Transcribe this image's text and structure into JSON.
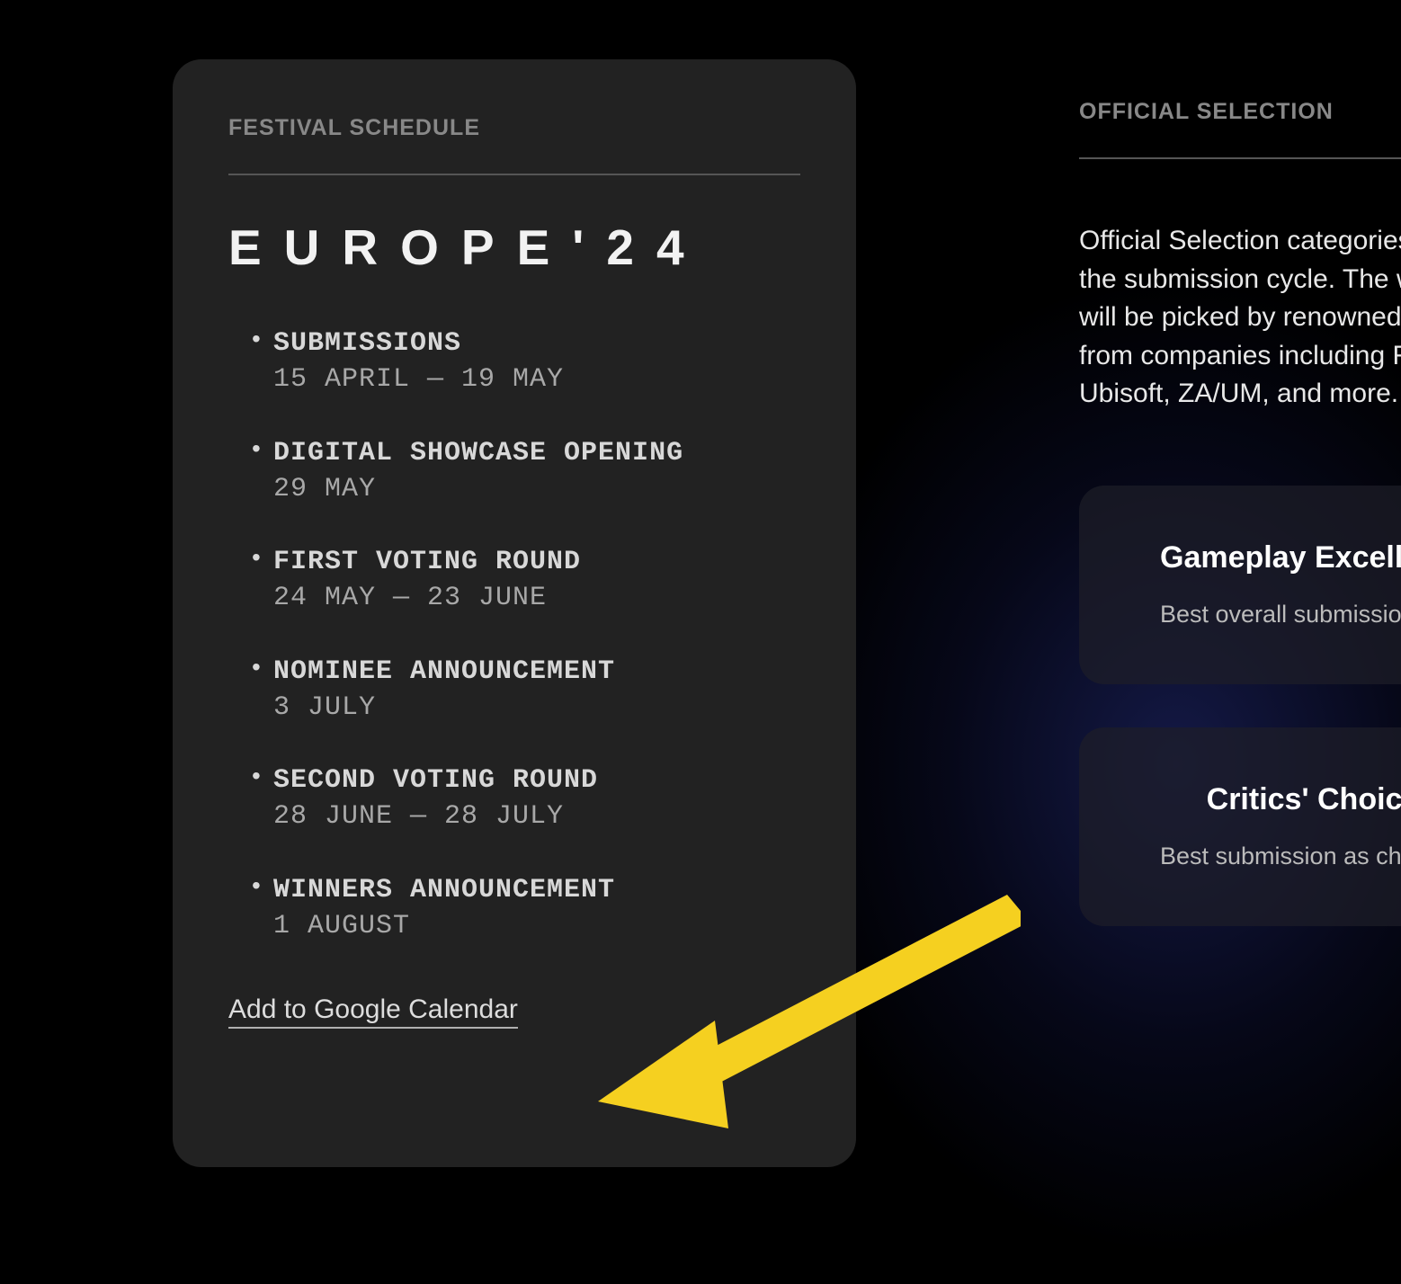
{
  "schedule": {
    "header": "FESTIVAL SCHEDULE",
    "title": "EUROPE'24",
    "items": [
      {
        "title": "SUBMISSIONS",
        "date": "15 APRIL — 19 MAY"
      },
      {
        "title": "DIGITAL SHOWCASE OPENING",
        "date": "29 MAY"
      },
      {
        "title": "FIRST VOTING ROUND",
        "date": "24 MAY — 23 JUNE"
      },
      {
        "title": "NOMINEE ANNOUNCEMENT",
        "date": "3 JULY"
      },
      {
        "title": "SECOND VOTING ROUND",
        "date": "28 JUNE — 28 JULY"
      },
      {
        "title": "WINNERS ANNOUNCEMENT",
        "date": "1 AUGUST"
      }
    ],
    "calendar_link": "Add to Google Calendar"
  },
  "selection": {
    "header": "OFFICIAL SELECTION",
    "description": "Official Selection categories during the submission cycle. The winners will be picked by renowned experts from companies including Remedy, Ubisoft, ZA/UM, and more."
  },
  "visible_description_partial": "Official Selection cate\ncycle. The winners wi\nexperts from compani\nUbisoft, ZA/UM, and ",
  "awards": [
    {
      "title": "Gameplay Excellence Award",
      "description": "Best overall submission of the festival"
    },
    {
      "title": "Critics' Choice",
      "description": "Best submission as chosen by members of the media"
    }
  ],
  "arrow_color": "#F5D020"
}
